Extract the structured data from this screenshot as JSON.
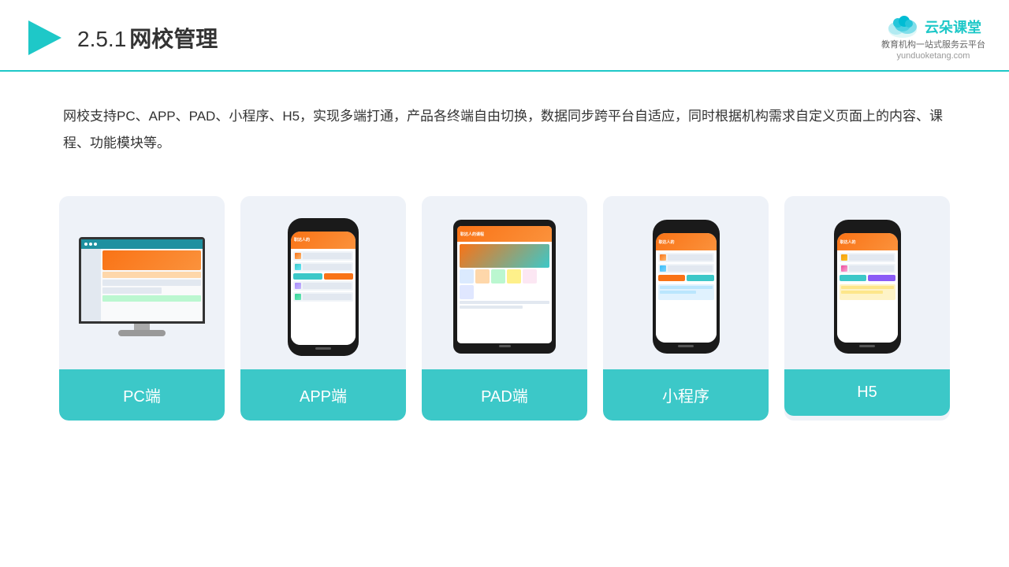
{
  "header": {
    "slide_number": "2.5.1",
    "title": "网校管理",
    "logo_name": "云朵课堂",
    "logo_url": "yunduoketang.com",
    "logo_tagline": "教育机构一站\n式服务云平台"
  },
  "description": {
    "text": "网校支持PC、APP、PAD、小程序、H5，实现多端打通，产品各终端自由切换，数据同步跨平台自适应，同时根据机构需求自定义页面上的内容、课程、功能模块等。"
  },
  "cards": [
    {
      "id": "pc",
      "label": "PC端"
    },
    {
      "id": "app",
      "label": "APP端"
    },
    {
      "id": "pad",
      "label": "PAD端"
    },
    {
      "id": "miniprogram",
      "label": "小程序"
    },
    {
      "id": "h5",
      "label": "H5"
    }
  ],
  "colors": {
    "teal": "#3cc8c8",
    "accent": "#f97316",
    "card_bg": "#eef2f8"
  }
}
